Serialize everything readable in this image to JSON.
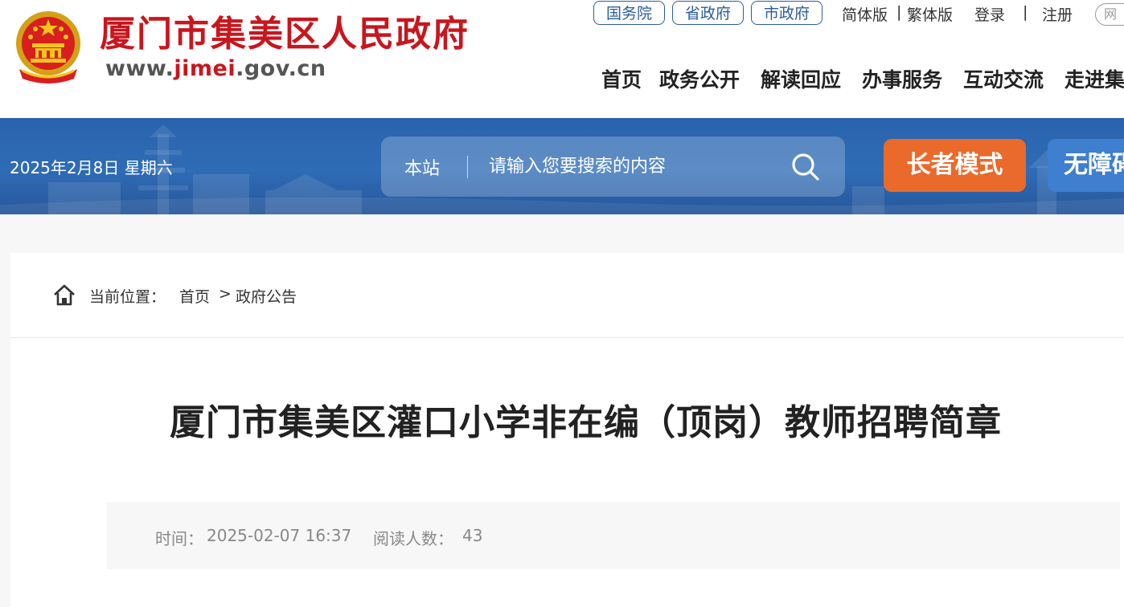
{
  "header": {
    "site_name": "厦门市集美区人民政府",
    "url_prefix": "www.",
    "url_highlight": "jimei",
    "url_suffix": ".gov.cn",
    "top_links": [
      "国务院",
      "省政府",
      "市政府"
    ],
    "lang_simplified": "简体版",
    "lang_sep": "|",
    "lang_traditional": "繁体版",
    "login": "登录",
    "user_sep": "|",
    "register": "注册",
    "partial_link": "网",
    "nav": [
      "首页",
      "政务公开",
      "解读回应",
      "办事服务",
      "互动交流",
      "走进集"
    ]
  },
  "banner": {
    "date": "2025年2月8日 星期六",
    "search_scope": "本站",
    "search_placeholder": "请输入您要搜索的内容",
    "elder_mode": "长者模式",
    "accessibility": "无障碍"
  },
  "breadcrumb": {
    "label": "当前位置：",
    "home": "首页",
    "sep": ">",
    "current": "政府公告"
  },
  "article": {
    "title": "厦门市集美区灌口小学非在编（顶岗）教师招聘简章",
    "time_label": "时间：",
    "time_value": "2025-02-07 16:37",
    "reads_label": "阅读人数：",
    "reads_value": "43"
  },
  "colors": {
    "brand_red": "#c8161d",
    "banner_blue": "#2f6cb6",
    "elder_orange": "#ea6a2b",
    "link_blue": "#2a5d9f"
  }
}
